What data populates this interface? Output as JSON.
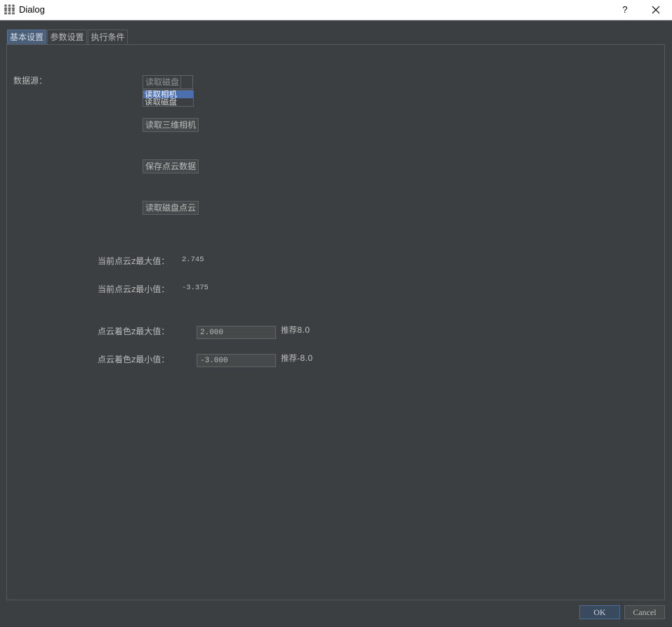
{
  "window": {
    "title": "Dialog",
    "help_label": "?",
    "app_icon": "people-group-icon",
    "close_icon": "close-icon"
  },
  "tabs": [
    {
      "label": "基本设置",
      "selected": true
    },
    {
      "label": "参数设置",
      "selected": false
    },
    {
      "label": "执行条件",
      "selected": false
    }
  ],
  "basic_settings": {
    "data_source": {
      "label": "数据源：",
      "selected_value": "读取磁盘",
      "dropdown_open": true,
      "options": [
        "读取相机",
        "读取磁盘"
      ],
      "highlighted_index": 0
    },
    "buttons": {
      "read_3d_camera": "读取三维相机",
      "save_point_cloud": "保存点云数据",
      "read_disk_point_cloud": "读取磁盘点云"
    },
    "current_z_max": {
      "label": "当前点云z最大值：",
      "value": "2.745"
    },
    "current_z_min": {
      "label": "当前点云z最小值：",
      "value": "-3.375"
    },
    "color_z_max": {
      "label": "点云着色z最大值：",
      "value": "2.000",
      "hint": "推荐8.0"
    },
    "color_z_min": {
      "label": "点云着色z最小值：",
      "value": "-3.000",
      "hint": "推荐-8.0"
    }
  },
  "footer": {
    "ok_label": "OK",
    "cancel_label": "Cancel"
  },
  "colors": {
    "background": "#3c3f41",
    "text": "#bbbbbb",
    "selection": "#4b6eaf",
    "selected_tab": "#4a5f7a",
    "default_button": "#394a5e"
  }
}
